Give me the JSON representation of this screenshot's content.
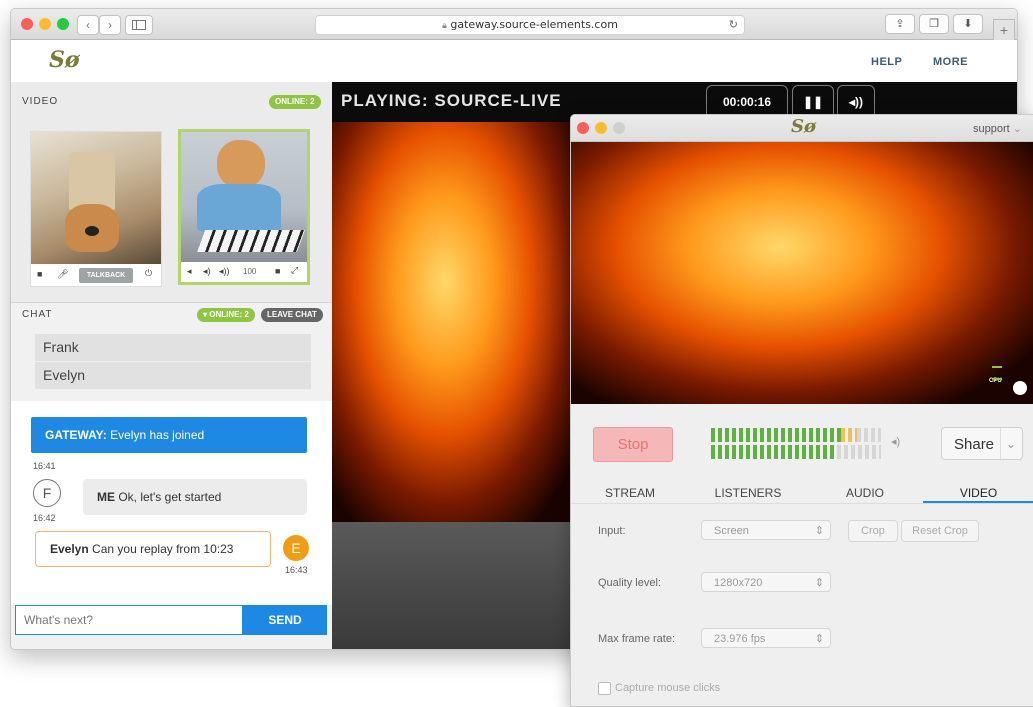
{
  "browser": {
    "url": "gateway.source-elements.com",
    "nav_back": "‹",
    "nav_forward": "›",
    "sidebar_icon": "sidebar-icon",
    "reload_icon": "↻",
    "new_tab": "+"
  },
  "header": {
    "logo": "Sø",
    "help": "HELP",
    "more": "MORE"
  },
  "video": {
    "section_title": "VIDEO",
    "online_badge": "ONLINE: 2",
    "tile1": {
      "talkback_label": "TALKBACK"
    },
    "tile2": {
      "volume_value": "100"
    }
  },
  "chat": {
    "section_title": "CHAT",
    "online_badge": "▾ ONLINE: 2",
    "leave_label": "LEAVE CHAT",
    "users": [
      "Frank",
      "Evelyn"
    ],
    "system_message": {
      "sender": "GATEWAY:",
      "text": "Evelyn has joined",
      "time": "16:41"
    },
    "my_message": {
      "avatar": "F",
      "sender": "ME",
      "text": "Ok, let's get started",
      "time": "16:42"
    },
    "other_message": {
      "avatar": "E",
      "sender": "Evelyn",
      "text": "Can you replay from 10:23",
      "time": "16:43"
    },
    "input_placeholder": "What's next?",
    "send_label": "SEND"
  },
  "player": {
    "title": "PLAYING: SOURCE-LIVE",
    "time": "00:00:16"
  },
  "popup": {
    "logo": "Sø",
    "account": "support",
    "cpu_label": "CPU",
    "stop_label": "Stop",
    "share_label": "Share",
    "tabs": [
      "STREAM",
      "LISTENERS",
      "AUDIO",
      "VIDEO"
    ],
    "active_tab": "VIDEO",
    "input_label": "Input:",
    "input_value": "Screen",
    "crop_label": "Crop",
    "reset_crop_label": "Reset Crop",
    "quality_label": "Quality level:",
    "quality_value": "1280x720",
    "framerate_label": "Max frame rate:",
    "framerate_value": "23.976 fps",
    "capture_label": "Capture mouse clicks"
  },
  "colors": {
    "accent_blue": "#1e88e5",
    "online_green": "#8dc63f",
    "stop_red": "#f5b7b7",
    "avatar_orange": "#f39c12"
  }
}
